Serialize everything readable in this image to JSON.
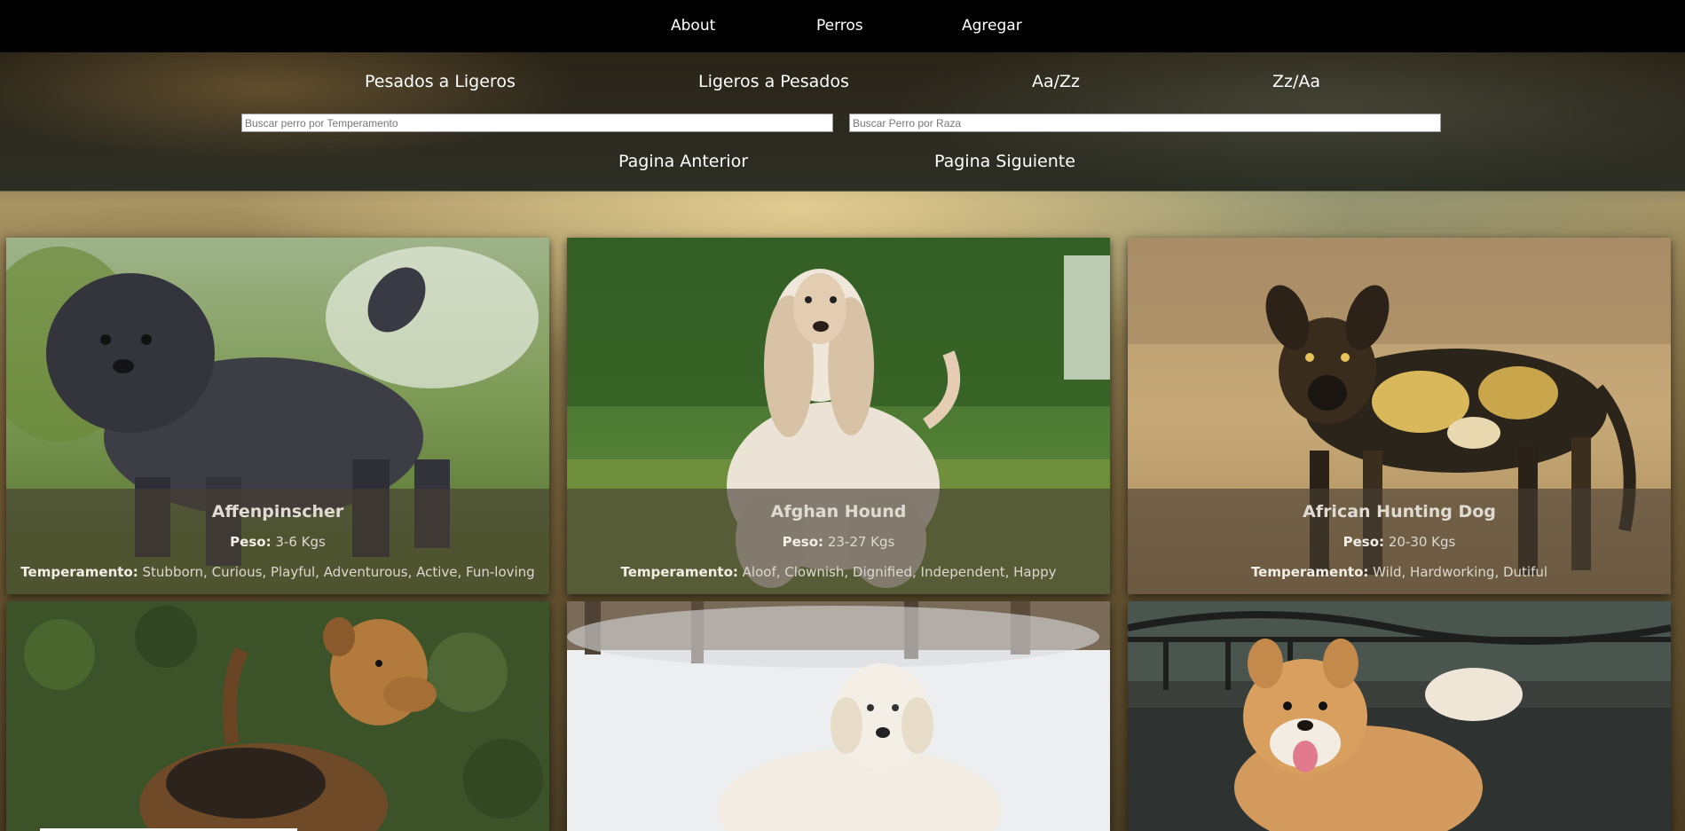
{
  "nav": {
    "about": "About",
    "perros": "Perros",
    "agregar": "Agregar"
  },
  "sort": {
    "heavy_to_light": "Pesados a Ligeros",
    "light_to_heavy": "Ligeros a Pesados",
    "a_z": "Aa/Zz",
    "z_a": "Zz/Aa"
  },
  "search": {
    "temperament_placeholder": "Buscar perro por Temperamento",
    "breed_placeholder": "Buscar Perro por Raza"
  },
  "pagination": {
    "prev": "Pagina Anterior",
    "next": "Pagina Siguiente"
  },
  "labels": {
    "peso": "Peso:",
    "temperamento": "Temperamento:"
  },
  "cards": [
    {
      "name": "Affenpinscher",
      "weight": "3-6 Kgs",
      "temperament": "Stubborn, Curious, Playful, Adventurous, Active, Fun-loving"
    },
    {
      "name": "Afghan Hound",
      "weight": "23-27 Kgs",
      "temperament": "Aloof, Clownish, Dignified, Independent, Happy"
    },
    {
      "name": "African Hunting Dog",
      "weight": "20-30 Kgs",
      "temperament": "Wild, Hardworking, Dutiful"
    },
    {
      "name": "",
      "weight": "",
      "temperament": ""
    },
    {
      "name": "",
      "weight": "",
      "temperament": ""
    },
    {
      "name": "",
      "weight": "",
      "temperament": ""
    }
  ]
}
